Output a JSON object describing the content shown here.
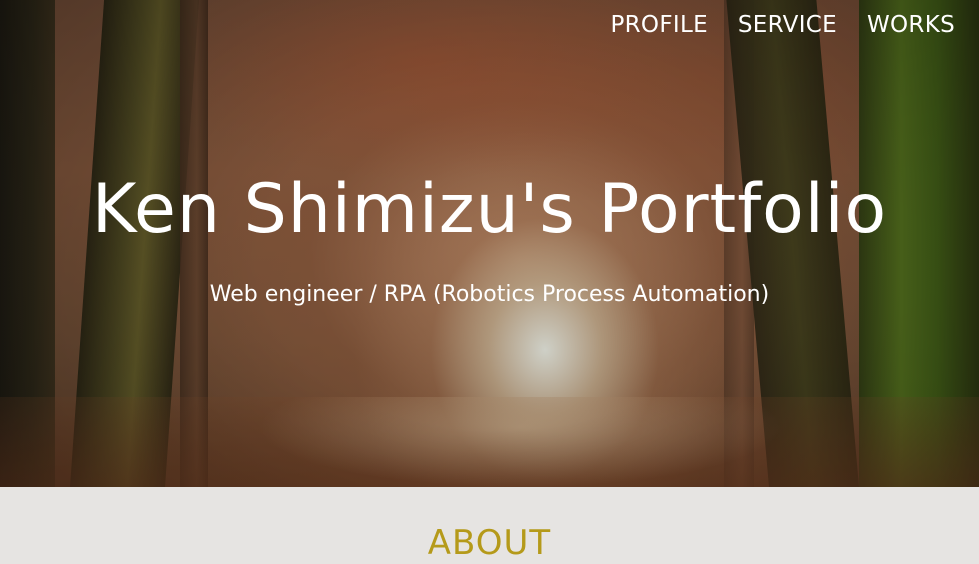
{
  "nav": {
    "items": [
      {
        "label": "PROFILE"
      },
      {
        "label": "SERVICE"
      },
      {
        "label": "WORKS"
      }
    ]
  },
  "hero": {
    "title": "Ken Shimizu's Portfolio",
    "subtitle": "Web engineer / RPA (Robotics Process Automation)"
  },
  "about": {
    "heading": "ABOUT"
  },
  "colors": {
    "nav_text": "#ffffff",
    "about_heading": "#b59a1a",
    "about_background": "#e6e4e2"
  }
}
